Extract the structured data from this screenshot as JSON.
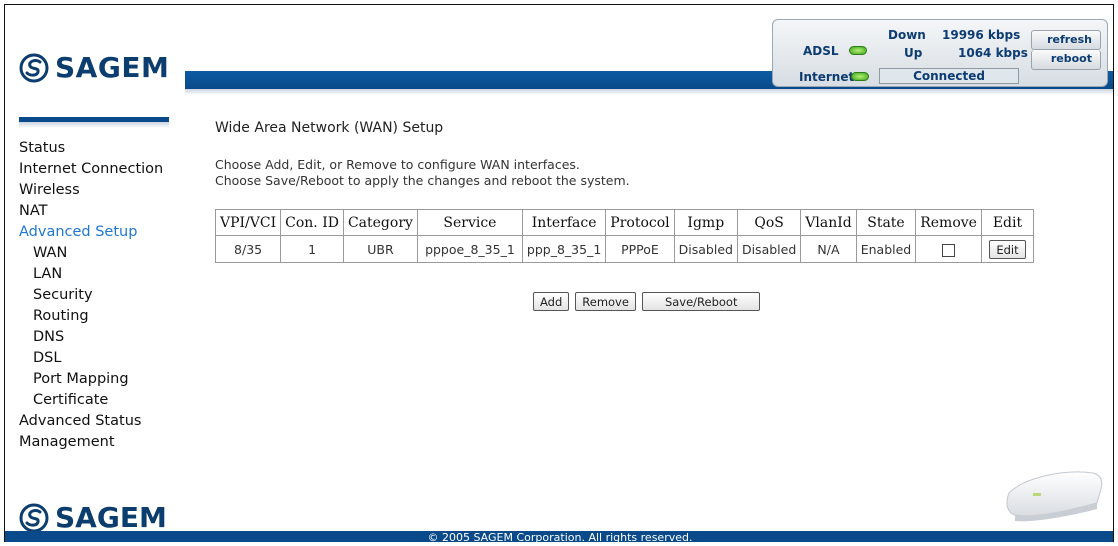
{
  "header": {
    "brand": "SAGEM"
  },
  "status": {
    "adsl_label": "ADSL",
    "internet_label": "Internet",
    "down_label": "Down",
    "down_value": "19996 kbps",
    "up_label": "Up",
    "up_value": "1064 kbps",
    "connection_state": "Connected",
    "refresh_label": "refresh",
    "reboot_label": "reboot",
    "led_color": "#3aa316"
  },
  "sidebar": {
    "items": [
      {
        "label": "Status"
      },
      {
        "label": "Internet Connection"
      },
      {
        "label": "Wireless"
      },
      {
        "label": "NAT"
      },
      {
        "label": "Advanced Setup"
      },
      {
        "label": "WAN"
      },
      {
        "label": "LAN"
      },
      {
        "label": "Security"
      },
      {
        "label": "Routing"
      },
      {
        "label": "DNS"
      },
      {
        "label": "DSL"
      },
      {
        "label": "Port Mapping"
      },
      {
        "label": "Certificate"
      },
      {
        "label": "Advanced Status"
      },
      {
        "label": "Management"
      }
    ],
    "active_color": "#1f77d0"
  },
  "main": {
    "title": "Wide Area Network (WAN) Setup",
    "desc_line1": "Choose Add, Edit, or Remove to configure WAN interfaces.",
    "desc_line2": "Choose Save/Reboot to apply the changes and reboot the system.",
    "table": {
      "headers": [
        "VPI/VCI",
        "Con. ID",
        "Category",
        "Service",
        "Interface",
        "Protocol",
        "Igmp",
        "QoS",
        "VlanId",
        "State",
        "Remove",
        "Edit"
      ],
      "rows": [
        {
          "vpi_vci": "8/35",
          "con_id": "1",
          "category": "UBR",
          "service": "pppoe_8_35_1",
          "interface": "ppp_8_35_1",
          "protocol": "PPPoE",
          "igmp": "Disabled",
          "qos": "Disabled",
          "vlanid": "N/A",
          "state": "Enabled",
          "remove_checked": false,
          "edit_label": "Edit"
        }
      ]
    },
    "add_label": "Add",
    "remove_label": "Remove",
    "save_reboot_label": "Save/Reboot"
  },
  "footer": {
    "copyright": "© 2005 SAGEM Corporation. All rights reserved."
  },
  "colors": {
    "brand_blue": "#0a4a8a",
    "logo_blue": "#0b3e6e"
  }
}
